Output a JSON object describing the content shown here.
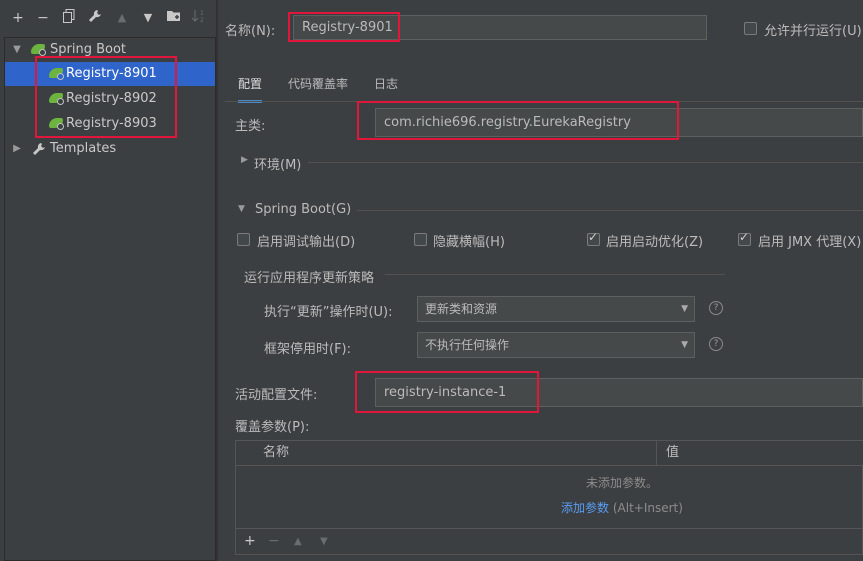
{
  "toolbar": {
    "add": "+",
    "remove": "−",
    "copy": "⧉",
    "edit": "🔧",
    "up": "▲",
    "down": "▼",
    "folder": "📁",
    "sort": "↓²"
  },
  "tree": {
    "group_label": "Spring Boot",
    "items": [
      {
        "label": "Registry-8901"
      },
      {
        "label": "Registry-8902"
      },
      {
        "label": "Registry-8903"
      }
    ],
    "templates_label": "Templates"
  },
  "form": {
    "name_label": "名称(N):",
    "name_value": "Registry-8901",
    "parallel_label": "允许并行运行(U)",
    "tabs": [
      "配置",
      "代码覆盖率",
      "日志"
    ],
    "main_class_label": "主类:",
    "main_class_value": "com.richie696.registry.EurekaRegistry",
    "env_label": "环境(M)",
    "spring_boot_label": "Spring Boot(G)",
    "options": [
      {
        "label": "启用调试输出(D)",
        "checked": false
      },
      {
        "label": "隐藏横幅(H)",
        "checked": false
      },
      {
        "label": "启用启动优化(Z)",
        "checked": true
      },
      {
        "label": "启用 JMX 代理(X)",
        "checked": true
      }
    ],
    "update_policy_label": "运行应用程序更新策略",
    "on_update_label": "执行“更新”操作时(U):",
    "on_update_value": "更新类和资源",
    "on_frame_label": "框架停用时(F):",
    "on_frame_value": "不执行任何操作",
    "active_profiles_label": "活动配置文件:",
    "active_profiles_value": "registry-instance-1",
    "override_label": "覆盖参数(P):",
    "table": {
      "columns": [
        "名称",
        "值"
      ],
      "empty_text": "未添加参数。",
      "add_link": "添加参数",
      "add_shortcut": "(Alt+Insert)"
    }
  },
  "colors": {
    "selection": "#2f65ca",
    "highlight_box": "#e0163a",
    "link": "#589df6",
    "spring_green": "#6db33f"
  }
}
